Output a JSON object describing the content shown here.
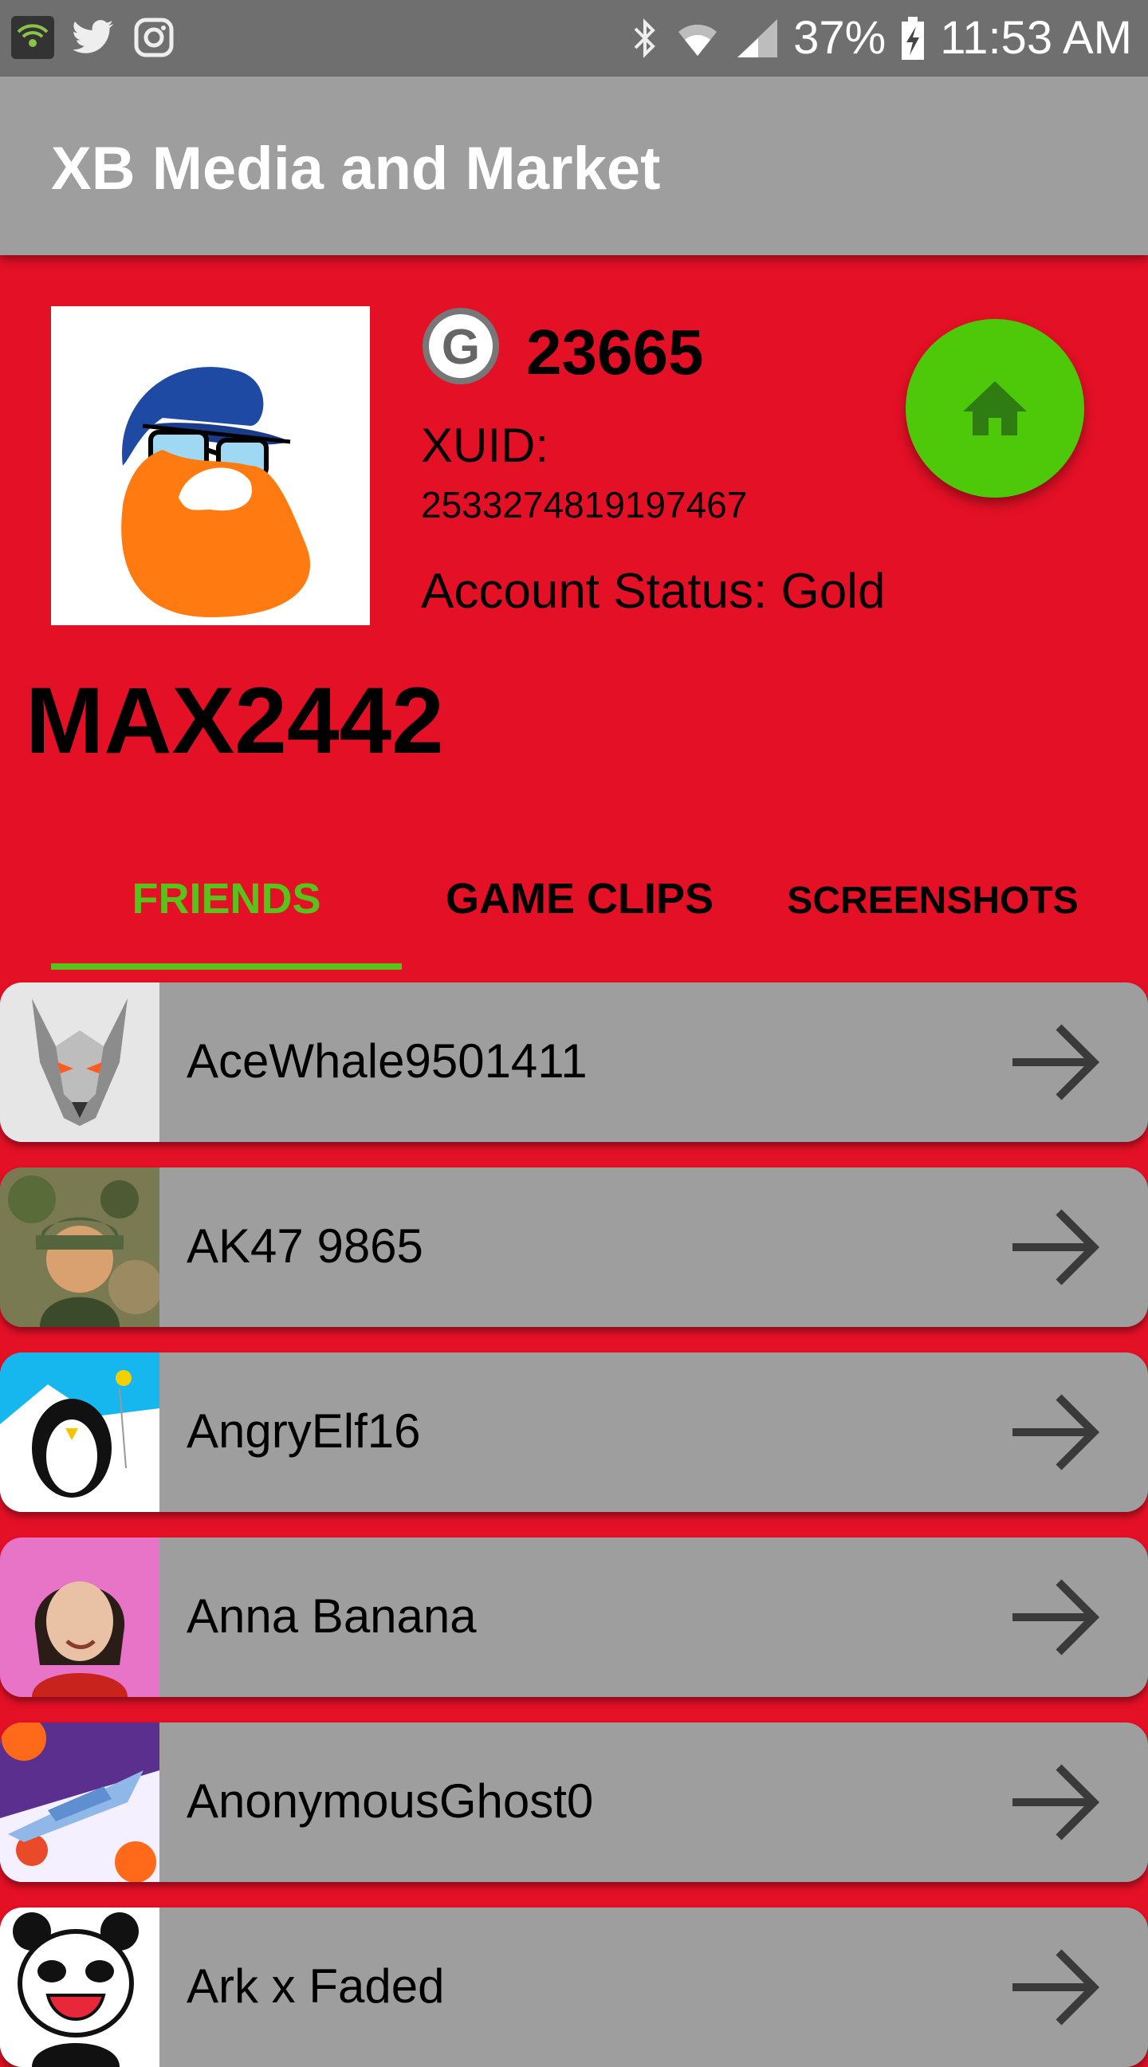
{
  "status_bar": {
    "icons_left": [
      "wifi-app-icon",
      "twitter-icon",
      "instagram-icon"
    ],
    "icons_right": [
      "bluetooth-icon",
      "wifi-icon",
      "signal-icon",
      "battery-charging-icon"
    ],
    "battery": "37%",
    "time": "11:53 AM"
  },
  "appbar": {
    "title": "XB Media and Market"
  },
  "profile": {
    "gamerscore_badge": "G",
    "gamerscore": "23665",
    "xuid_label": "XUID:",
    "xuid": "2533274819197467",
    "account_status": "Account Status:  Gold",
    "gamertag": "MAX2442"
  },
  "tabs": [
    {
      "label": "FRIENDS",
      "selected": true
    },
    {
      "label": "GAME CLIPS",
      "selected": false
    },
    {
      "label": "SCREENSHOTS",
      "selected": false
    }
  ],
  "friends": [
    {
      "name": "AceWhale9501411"
    },
    {
      "name": "AK47 9865"
    },
    {
      "name": "AngryElf16"
    },
    {
      "name": "Anna Banana"
    },
    {
      "name": "AnonymousGhost0"
    },
    {
      "name": "Ark x Faded"
    }
  ],
  "colors": {
    "background": "#e31026",
    "appbar": "#9e9e9e",
    "accent_green": "#57c31b",
    "fab": "#4dc90a",
    "row": "#9e9e9e"
  }
}
